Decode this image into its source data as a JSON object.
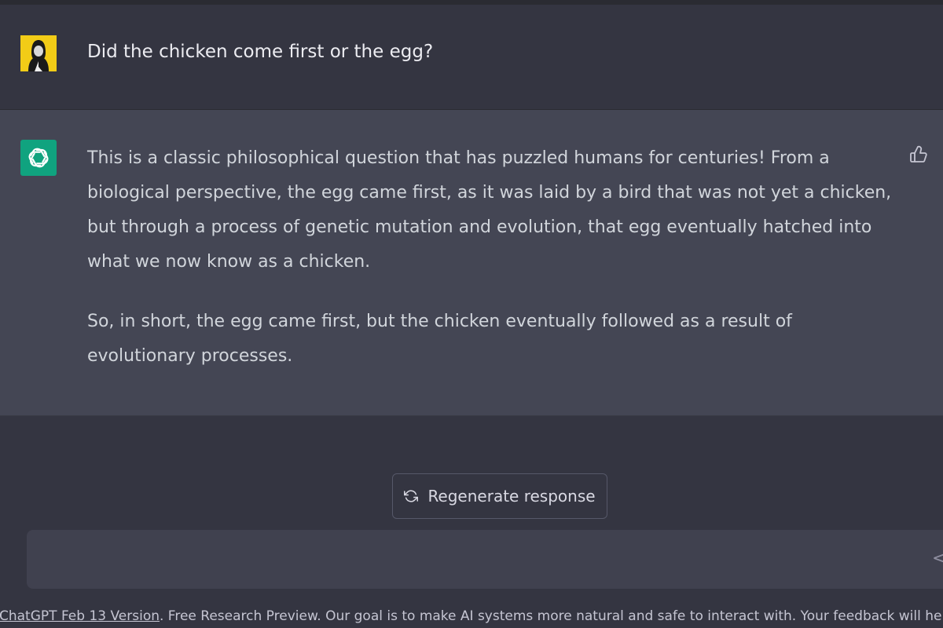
{
  "conversation": {
    "user_message": "Did the chicken come first or the egg?",
    "assistant_paragraphs": [
      "This is a classic philosophical question that has puzzled humans for centuries! From a biological perspective, the egg came first, as it was laid by a bird that was not yet a chicken, but through a process of genetic mutation and evolution, that egg eventually hatched into what we now know as a chicken.",
      "So, in short, the egg came first, but the chicken eventually followed as a result of evolutionary processes."
    ]
  },
  "actions": {
    "regenerate_label": "Regenerate response"
  },
  "footer": {
    "version_link": "ChatGPT Feb 13 Version",
    "text": ". Free Research Preview. Our goal is to make AI systems more natural and safe to interact with. Your feedback will help us improve."
  },
  "icons": {
    "user_avatar": "user-photo-avatar",
    "assistant_avatar": "openai-logo-icon",
    "feedback": "thumbs-up-icon",
    "regenerate": "refresh-icon",
    "send": "send-icon"
  },
  "colors": {
    "background": "#343541",
    "assistant_row": "#444654",
    "accent_green": "#10a37f",
    "avatar_yellow": "#f2cc17",
    "input": "#40414f"
  }
}
